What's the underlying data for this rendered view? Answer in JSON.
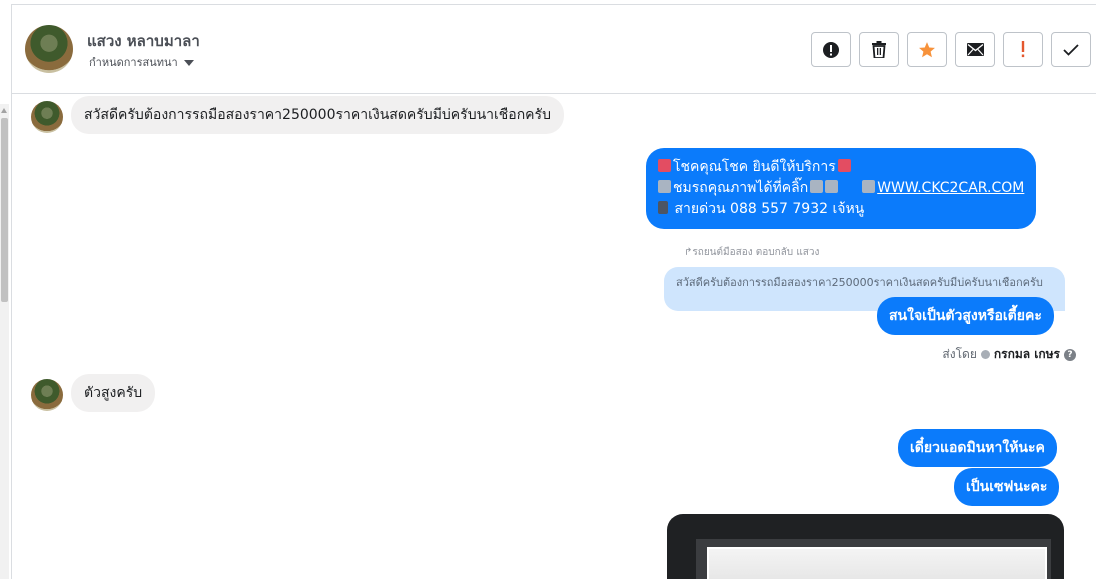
{
  "header": {
    "contact_name": "แสวง หลาบมาลา",
    "assign_label": "กำหนดการสนทนา",
    "actions": [
      {
        "name": "report-spam-button",
        "icon": "exclamation-circle-icon"
      },
      {
        "name": "delete-button",
        "icon": "trash-icon"
      },
      {
        "name": "star-button",
        "icon": "star-icon"
      },
      {
        "name": "mark-unread-button",
        "icon": "envelope-icon"
      },
      {
        "name": "follow-up-button",
        "icon": "exclamation-icon"
      },
      {
        "name": "mark-done-button",
        "icon": "check-icon"
      }
    ]
  },
  "messages": {
    "m1": "สวัสดีครับต้องการรถมือสองราคา250000ราคาเงินสดครับมีบ่ครับนาเชือกครับ",
    "greeting_line1": "โชคคุณโชค ยินดีให้บริการ",
    "greeting_line2": "ชมรถคุณภาพได้ที่คลิ๊ก",
    "greeting_url": "WWW.CKC2CAR.COM",
    "greeting_line3": "สายด่วน 088 557 7932 เจ้หนู",
    "reply_meta": "รถยนต์มือสอง ตอบกลับ แสวง",
    "reply_quote": "สวัสดีครับต้องการรถมือสองราคา250000ราคาเงินสดครับมีบ่ครับนาเชือกครับ",
    "reply_text": "สนใจเป็นตัวสูงหรือเตี้ยคะ",
    "sent_by_label": "ส่งโดย",
    "sent_by_name": "กรกมล เกษร",
    "m2": "ตัวสูงครับ",
    "m3": "เดี๋ยวแอดมินหาให้นะค",
    "m4": "เป็นเซฟนะคะ"
  },
  "colors": {
    "outgoing_bubble": "#0b7bfb",
    "incoming_bubble": "#f1f0f0",
    "star": "#f7923b",
    "follow_up": "#e4572e"
  }
}
